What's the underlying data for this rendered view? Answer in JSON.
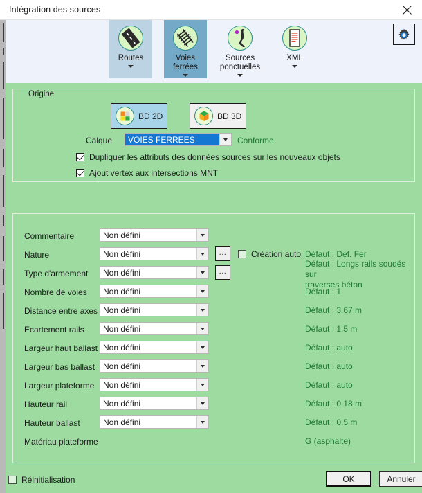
{
  "window": {
    "title": "Intégration des sources",
    "close_icon": "close-icon"
  },
  "ribbon": {
    "gear_icon": "gear-settings-icon",
    "tabs": [
      {
        "label_line1": "Routes",
        "label_line2": "",
        "icon": "road-icon",
        "state": "shade",
        "has_caret": true
      },
      {
        "label_line1": "Voies",
        "label_line2": "ferrées",
        "icon": "railway-track-icon",
        "state": "active",
        "has_caret": true
      },
      {
        "label_line1": "Sources",
        "label_line2": "ponctuelles",
        "icon": "point-source-icon",
        "state": "plain",
        "has_caret": true
      },
      {
        "label_line1": "XML",
        "label_line2": "",
        "icon": "xml-document-icon",
        "state": "plain",
        "has_caret": true
      }
    ]
  },
  "origine": {
    "legend": "Origine",
    "bd2d": {
      "label": "BD 2D",
      "icon": "bd-2d-icon",
      "selected": true
    },
    "bd3d": {
      "label": "BD 3D",
      "icon": "bd-3d-icon",
      "selected": false
    },
    "calque_label": "Calque",
    "calque_value": "VOIES FERREES",
    "conforme": "Conforme",
    "checkboxes": [
      {
        "label": "Dupliquer les attributs des données sources sur les nouveaux objets",
        "checked": true
      },
      {
        "label": "Ajout vertex aux intersections MNT",
        "checked": true
      }
    ]
  },
  "params": {
    "combo_value": "Non défini",
    "dots_label": "...",
    "creation_auto": {
      "label": "Création auto",
      "checked": false
    },
    "rows": [
      {
        "label": "Commentaire",
        "value": "Non défini",
        "dots": false,
        "defaut": ""
      },
      {
        "label": "Nature",
        "value": "Non défini",
        "dots": true,
        "defaut": "Défaut : Def. Fer"
      },
      {
        "label": "Type d'armement",
        "value": "Non défini",
        "dots": true,
        "defaut": "Défaut : Longs rails soudés sur\ntraverses béton"
      },
      {
        "label": "Nombre de voies",
        "value": "Non défini",
        "dots": false,
        "defaut": "Défaut : 1"
      },
      {
        "label": "Distance entre axes",
        "value": "Non défini",
        "dots": false,
        "defaut": "Défaut : 3.67 m"
      },
      {
        "label": "Ecartement rails",
        "value": "Non défini",
        "dots": false,
        "defaut": "Défaut : 1.5 m"
      },
      {
        "label": "Largeur haut ballast",
        "value": "Non défini",
        "dots": false,
        "defaut": "Défaut : auto"
      },
      {
        "label": "Largeur bas ballast",
        "value": "Non défini",
        "dots": false,
        "defaut": "Défaut : auto"
      },
      {
        "label": "Largeur plateforme",
        "value": "Non défini",
        "dots": false,
        "defaut": "Défaut : auto"
      },
      {
        "label": "Hauteur rail",
        "value": "Non défini",
        "dots": false,
        "defaut": "Défaut : 0.18 m"
      },
      {
        "label": "Hauteur ballast",
        "value": "Non défini",
        "dots": false,
        "defaut": "Défaut : 0.5 m"
      },
      {
        "label": "Matériau plateforme",
        "value": "",
        "dots": false,
        "defaut": "G (asphalte)"
      }
    ]
  },
  "footer": {
    "reinit": {
      "label": "Réinitialisation",
      "checked": false
    },
    "ok": "OK",
    "cancel": "Annuler"
  },
  "colors": {
    "green_panel": "#9ddba1",
    "green_text": "#1f7a33",
    "ribbon_bg": "#eef2fb",
    "tab_shade": "#bcd3e4",
    "tab_active": "#74a9c7",
    "combo_selection": "#1478d2"
  }
}
